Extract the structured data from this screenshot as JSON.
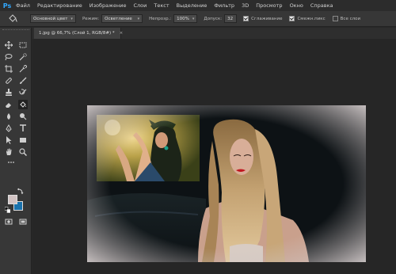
{
  "app": {
    "logo": "Ps"
  },
  "menu": [
    "Файл",
    "Редактирование",
    "Изображение",
    "Слои",
    "Текст",
    "Выделение",
    "Фильтр",
    "3D",
    "Просмотр",
    "Окно",
    "Справка"
  ],
  "options": {
    "brush_mode_value": "Основной цвет",
    "mode_label": "Режим:",
    "mode_value": "Осветление",
    "opacity_label": "Непрозр.:",
    "opacity_value": "100%",
    "tolerance_label": "Допуск:",
    "tolerance_value": "32",
    "antialias_label": "Сглаживание",
    "antialias_checked": true,
    "contiguous_label": "Смежн.пикс",
    "contiguous_checked": true,
    "all_layers_label": "Все слои",
    "all_layers_checked": false
  },
  "document": {
    "tab_title": "1.jpg @ 66,7% (Слой 1, RGB/8#) *",
    "tab_close": "×"
  },
  "colors": {
    "foreground": "#d2c3c3",
    "background": "#1a72ad",
    "accent": "#31a8ff"
  },
  "tools": [
    "move-tool-icon",
    "marquee-tool-icon",
    "lasso-tool-icon",
    "quick-select-icon",
    "crop-tool-icon",
    "eyedropper-icon",
    "healing-brush-icon",
    "brush-tool-icon",
    "clone-stamp-icon",
    "history-brush-icon",
    "eraser-icon",
    "paint-bucket-icon",
    "blur-tool-icon",
    "dodge-tool-icon",
    "pen-tool-icon",
    "text-tool-icon",
    "path-select-icon",
    "shape-tool-icon",
    "hand-tool-icon",
    "zoom-tool-icon"
  ]
}
